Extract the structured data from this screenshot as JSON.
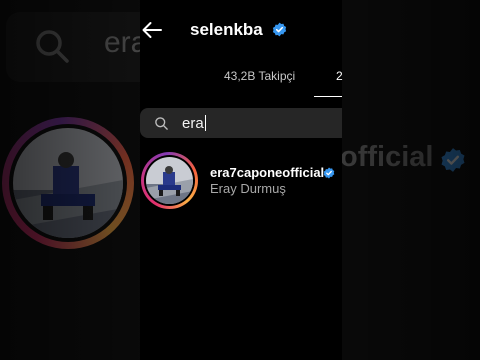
{
  "header": {
    "title": "selenkba",
    "back_icon": "arrow-left-icon",
    "verified_icon": "verified-badge-icon"
  },
  "tabs": [
    {
      "label": "43,2B Takipçi"
    },
    {
      "label": "2"
    }
  ],
  "search": {
    "value": "era",
    "icon": "search-icon"
  },
  "results": [
    {
      "username": "era7caponeofficial",
      "full_name": "Eray Durmuş",
      "verified": true
    }
  ],
  "background": {
    "search_text": "era",
    "username_fragment": "official"
  },
  "colors": {
    "background": "#000000",
    "search_field": "#262626",
    "verified_blue": "#3797f0",
    "secondary_text": "#a8a8a8"
  }
}
